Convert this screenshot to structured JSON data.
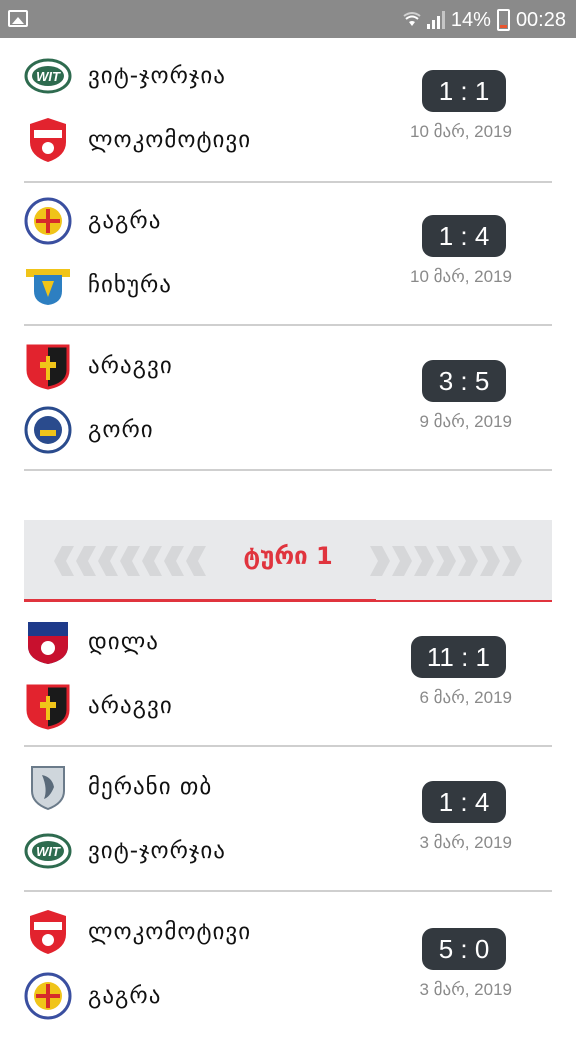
{
  "status_bar": {
    "battery": "14%",
    "time": "00:28"
  },
  "round": {
    "title": "ტური 1"
  },
  "matches": [
    {
      "home": "ვიტ-ჯორჯია",
      "home_logo": "witgeorgia-logo",
      "away": "ლოკომოტივი",
      "away_logo": "lokomotivi-logo",
      "score": "1 : 1",
      "date": "10 მარ, 2019"
    },
    {
      "home": "გაგრა",
      "home_logo": "gagra-logo",
      "away": "ჩიხურა",
      "away_logo": "chikhura-logo",
      "score": "1 : 4",
      "date": "10 მარ, 2019"
    },
    {
      "home": "არაგვი",
      "home_logo": "aragvi-logo",
      "away": "გორი",
      "away_logo": "gori-logo",
      "score": "3 : 5",
      "date": "9 მარ, 2019"
    },
    {
      "home": "დილა",
      "home_logo": "dila-logo",
      "away": "არაგვი",
      "away_logo": "aragvi-logo",
      "score": "11 : 1",
      "date": "6 მარ, 2019"
    },
    {
      "home": "მერანი თბ",
      "home_logo": "merani-logo",
      "away": "ვიტ-ჯორჯია",
      "away_logo": "witgeorgia-logo",
      "score": "1 : 4",
      "date": "3 მარ, 2019"
    },
    {
      "home": "ლოკომოტივი",
      "home_logo": "lokomotivi-logo",
      "away": "გაგრა",
      "away_logo": "gagra-logo",
      "score": "5 : 0",
      "date": "3 მარ, 2019"
    }
  ]
}
